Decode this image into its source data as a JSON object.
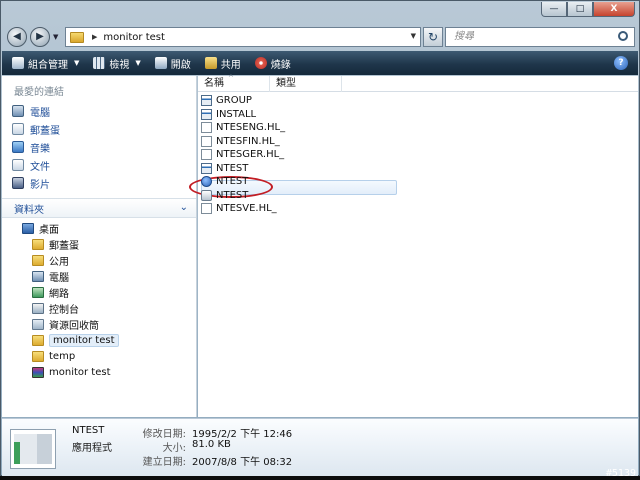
{
  "window": {
    "min": "—",
    "max": "□",
    "close": "X"
  },
  "address": {
    "path": "monitor test"
  },
  "search": {
    "placeholder": "搜尋"
  },
  "toolbar": {
    "organize": "組合管理",
    "views": "檢視",
    "open": "開啟",
    "share": "共用",
    "burn": "燒錄",
    "help": "?"
  },
  "favorites": {
    "title": "最愛的連結",
    "items": [
      {
        "label": "電腦",
        "icon": "computer-icon"
      },
      {
        "label": "郵蓋蛋",
        "icon": "doc-icon"
      },
      {
        "label": "音樂",
        "icon": "music-icon"
      },
      {
        "label": "文件",
        "icon": "doc-icon"
      },
      {
        "label": "影片",
        "icon": "film-icon"
      }
    ]
  },
  "folders": {
    "title": "資料夾",
    "items": [
      {
        "label": "桌面",
        "icon": "desktop-icon"
      },
      {
        "label": "郵蓋蛋",
        "icon": "folder-icon"
      },
      {
        "label": "公用",
        "icon": "folder-icon"
      },
      {
        "label": "電腦",
        "icon": "computer-icon"
      },
      {
        "label": "網路",
        "icon": "network-icon"
      },
      {
        "label": "控制台",
        "icon": "control-panel-icon"
      },
      {
        "label": "資源回收筒",
        "icon": "recycle-bin-icon"
      },
      {
        "label": "monitor test",
        "icon": "folder-icon"
      },
      {
        "label": "temp",
        "icon": "folder-icon"
      },
      {
        "label": "monitor test",
        "icon": "archive-icon"
      }
    ]
  },
  "columns": {
    "name": "名稱",
    "type": "類型"
  },
  "files": [
    {
      "name": "GROUP",
      "icon": "app-icon"
    },
    {
      "name": "INSTALL",
      "icon": "app-icon"
    },
    {
      "name": "NTESENG.HL_",
      "icon": "text-file-icon"
    },
    {
      "name": "NTESFIN.HL_",
      "icon": "text-file-icon"
    },
    {
      "name": "NTESGER.HL_",
      "icon": "text-file-icon"
    },
    {
      "name": "NTEST",
      "icon": "app-icon"
    },
    {
      "name": "NTEST",
      "icon": "help-file-icon"
    },
    {
      "name": "NTEST",
      "icon": "system-file-icon"
    },
    {
      "name": "NTESVE.HL_",
      "icon": "text-file-icon"
    }
  ],
  "details": {
    "name": "NTEST",
    "kind": "應用程式",
    "labels": [
      "修改日期:",
      "大小:",
      "建立日期:"
    ],
    "values": [
      "1995/2/2 下午 12:46",
      "81.0 KB",
      "2007/8/8 下午 08:32"
    ]
  },
  "watermark": "#5139"
}
